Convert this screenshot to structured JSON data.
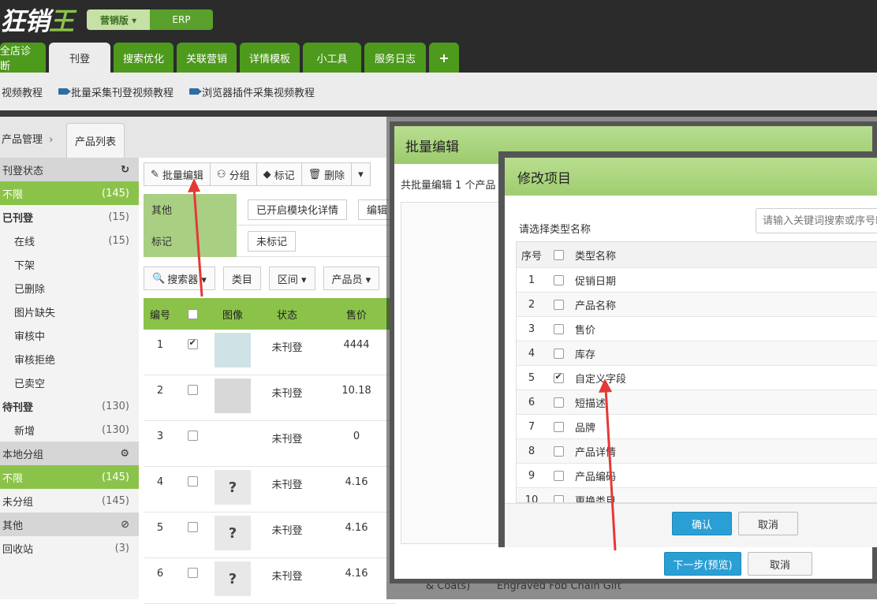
{
  "header": {
    "logo_main": "狂销",
    "logo_accent": "王",
    "edition_label": "营销版 ▾",
    "erp_label": "ERP"
  },
  "tabs": [
    {
      "label": "全店诊断"
    },
    {
      "label": "刊登"
    },
    {
      "label": "搜索优化"
    },
    {
      "label": "关联营销"
    },
    {
      "label": "详情模板"
    },
    {
      "label": "小工具"
    },
    {
      "label": "服务日志"
    },
    {
      "label": "+"
    }
  ],
  "subnav": {
    "video": "视频教程",
    "batch_video": "批量采集刊登视频教程",
    "plugin_video": "浏览器插件采集视频教程"
  },
  "breadcrumb": {
    "root": "产品管理",
    "sep": "›",
    "tab": "产品列表"
  },
  "sidebar": {
    "status_title": "刊登状态",
    "refresh_icon": "↻",
    "items": [
      {
        "label": "不限",
        "count": "(145)"
      },
      {
        "label": "已刊登",
        "count": "(15)"
      },
      {
        "label": "在线",
        "count": "(15)"
      },
      {
        "label": "下架",
        "count": ""
      },
      {
        "label": "已删除",
        "count": ""
      },
      {
        "label": "图片缺失",
        "count": ""
      },
      {
        "label": "审核中",
        "count": ""
      },
      {
        "label": "审核拒绝",
        "count": ""
      },
      {
        "label": "已卖空",
        "count": ""
      },
      {
        "label": "待刊登",
        "count": "(130)"
      },
      {
        "label": "新增",
        "count": "(130)"
      }
    ],
    "group_title": "本地分组",
    "gear_icon": "⚙",
    "group_items": [
      {
        "label": "不限",
        "count": "(145)"
      },
      {
        "label": "未分组",
        "count": "(145)"
      }
    ],
    "other_title": "其他",
    "block_icon": "⊘",
    "other_items": [
      {
        "label": "回收站",
        "count": "(3)"
      }
    ]
  },
  "toolbar": {
    "batch_edit": "批量编辑",
    "group": "分组",
    "tag": "标记",
    "delete": "删除",
    "more": "▾"
  },
  "filters": {
    "other_label": "其他",
    "other_chip": "已开启模块化详情",
    "other_chip2": "编辑",
    "tag_label": "标记",
    "tag_chip": "未标记"
  },
  "search_row": {
    "searcher": "搜索器 ▾",
    "category": "类目",
    "range": "区间 ▾",
    "staff": "产品员 ▾"
  },
  "table": {
    "headers": [
      "编号",
      "",
      "图像",
      "状态",
      "售价"
    ],
    "rows": [
      {
        "id": "1",
        "status": "未刊登",
        "price": "4444",
        "checked": true
      },
      {
        "id": "2",
        "status": "未刊登",
        "price": "10.18",
        "checked": false
      },
      {
        "id": "3",
        "status": "未刊登",
        "price": "0",
        "checked": false
      },
      {
        "id": "4",
        "status": "未刊登",
        "price": "4.16",
        "checked": false
      },
      {
        "id": "5",
        "status": "未刊登",
        "price": "4.16",
        "checked": false
      },
      {
        "id": "6",
        "status": "未刊登",
        "price": "4.16",
        "checked": false
      }
    ],
    "placeholder_icon": "?"
  },
  "batch_dialog": {
    "title": "批量编辑",
    "subtitle": "共批量编辑 1 个产品",
    "next_button": "下一步(预览)",
    "cancel_button": "取消"
  },
  "modify_dialog": {
    "title": "修改项目",
    "type_label": "请选择类型名称",
    "search_placeholder": "请输入关键词搜索或序号ID",
    "col_index": "序号",
    "col_name": "类型名称",
    "items": [
      {
        "n": "1",
        "name": "促销日期",
        "checked": false
      },
      {
        "n": "2",
        "name": "产品名称",
        "checked": false
      },
      {
        "n": "3",
        "name": "售价",
        "checked": false
      },
      {
        "n": "4",
        "name": "库存",
        "checked": false
      },
      {
        "n": "5",
        "name": "自定义字段",
        "checked": true
      },
      {
        "n": "6",
        "name": "短描述",
        "checked": false
      },
      {
        "n": "7",
        "name": "品牌",
        "checked": false
      },
      {
        "n": "8",
        "name": "产品详情",
        "checked": false
      },
      {
        "n": "9",
        "name": "产品编码",
        "checked": false
      },
      {
        "n": "10",
        "name": "更换类目",
        "checked": false
      }
    ],
    "confirm_button": "确认",
    "cancel_button": "取消"
  },
  "below_text": {
    "left": "& Coats)",
    "right": "Engraved Fob Chain Gift"
  },
  "colors": {
    "green": "#4d9a1c",
    "light_green": "#8bc34a",
    "primary_blue": "#2a9fd6",
    "arrow_red": "#e53935"
  }
}
